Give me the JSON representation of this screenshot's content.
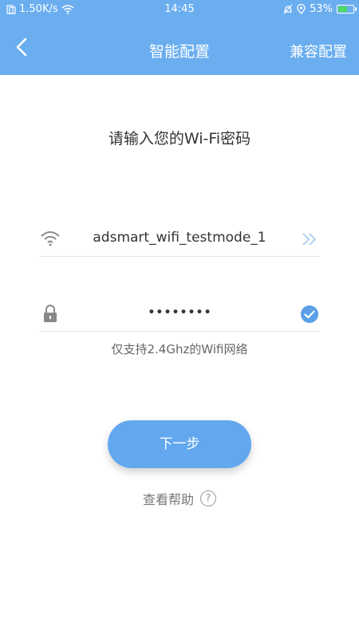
{
  "status_bar": {
    "network_speed": "1.50K/s",
    "time": "14:45",
    "battery_percent": "53%",
    "battery_level": 0.53
  },
  "nav": {
    "title": "智能配置",
    "compat_label": "兼容配置"
  },
  "main": {
    "prompt": "请输入您的Wi-Fi密码",
    "ssid_value": "adsmart_wifi_testmode_1",
    "password_masked": "••••••••",
    "hint": "仅支持2.4Ghz的Wifi网络",
    "next_button": "下一步",
    "help_label": "查看帮助",
    "help_icon_glyph": "?"
  },
  "colors": {
    "primary": "#6aaef0",
    "button": "#63a8ef",
    "check": "#5a9fe8"
  }
}
